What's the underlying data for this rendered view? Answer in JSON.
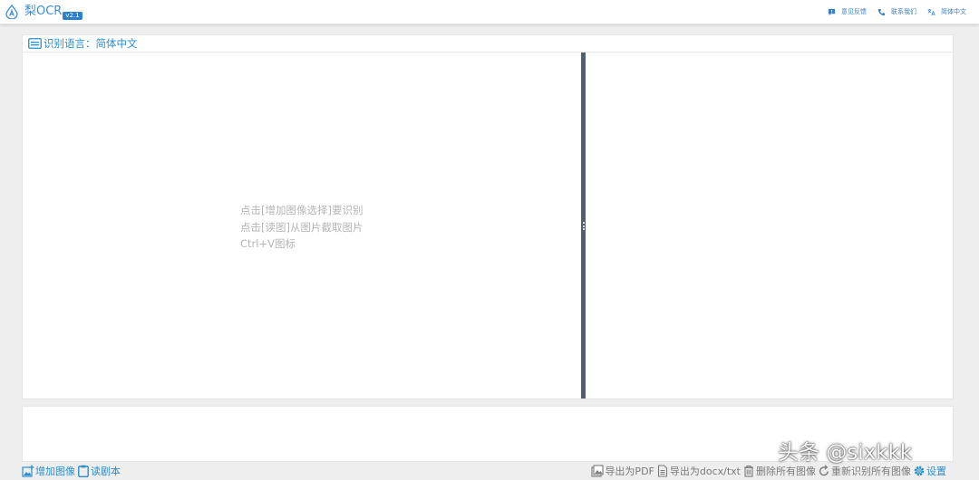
{
  "app": {
    "name": "梨OCR",
    "version": "v2.1",
    "logo_icon": "a-drop-logo-icon",
    "accent": "#2b8fcf"
  },
  "header": {
    "links": [
      {
        "label": "意见反馈",
        "icon": "feedback-icon"
      },
      {
        "label": "联系我们",
        "icon": "phone-icon"
      },
      {
        "label": "简体中文",
        "icon": "translate-icon"
      }
    ]
  },
  "language_bar": {
    "label": "识别语言：简体中文",
    "icon": "keyboard-icon"
  },
  "left_pane": {
    "hints": [
      "点击[增加图像选择]要识别",
      "点击[读图]从图片截取图片",
      "Ctrl+V图标"
    ]
  },
  "toolbar": {
    "left": [
      {
        "label": "增加图像",
        "icon": "add-image-icon"
      },
      {
        "label": "读剧本",
        "icon": "clipboard-icon"
      }
    ],
    "right": [
      {
        "label": "导出为PDF",
        "icon": "export-pdf-icon"
      },
      {
        "label": "导出为docx/txt",
        "icon": "document-icon"
      },
      {
        "label": "删除所有图像",
        "icon": "trash-icon"
      },
      {
        "label": "重新识别所有图像",
        "icon": "refresh-icon"
      },
      {
        "label": "设置",
        "icon": "gear-icon"
      }
    ]
  },
  "watermark": "头条 @sixkkk"
}
